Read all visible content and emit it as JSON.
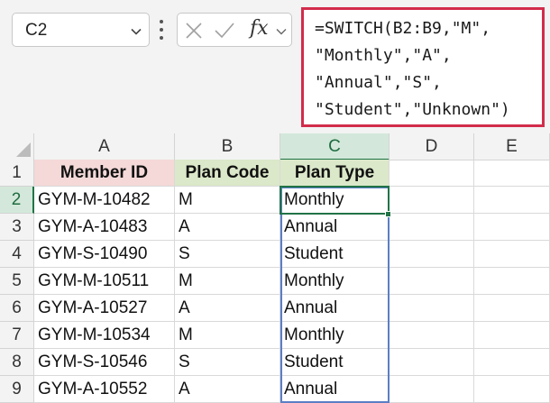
{
  "name_box": {
    "value": "C2"
  },
  "formula_bar": {
    "fx_label": "fx",
    "lines": [
      "=SWITCH(B2:B9,\"M\",",
      "\"Monthly\",\"A\",",
      "\"Annual\",\"S\",",
      "\"Student\",\"Unknown\")"
    ]
  },
  "sheet": {
    "columns": [
      "A",
      "B",
      "C",
      "D",
      "E"
    ],
    "rows": [
      "1",
      "2",
      "3",
      "4",
      "5",
      "6",
      "7",
      "8",
      "9"
    ],
    "headers": [
      "Member ID",
      "Plan Code",
      "Plan Type"
    ],
    "data": [
      [
        "GYM-M-10482",
        "M",
        "Monthly"
      ],
      [
        "GYM-A-10483",
        "A",
        "Annual"
      ],
      [
        "GYM-S-10490",
        "S",
        "Student"
      ],
      [
        "GYM-M-10511",
        "M",
        "Monthly"
      ],
      [
        "GYM-A-10527",
        "A",
        "Annual"
      ],
      [
        "GYM-M-10534",
        "M",
        "Monthly"
      ],
      [
        "GYM-S-10546",
        "S",
        "Student"
      ],
      [
        "GYM-A-10552",
        "A",
        "Annual"
      ]
    ],
    "active_cell": "C2"
  },
  "colors": {
    "formula_border": "#d22c4b",
    "header_a_fill": "#f4d9d8",
    "header_bc_fill": "#dbe8c9",
    "active_green": "#217346",
    "selection_blue": "#5b7fc4"
  },
  "icons": {
    "cancel": "x-icon",
    "confirm": "check-icon",
    "dropdown": "chevron-down-icon",
    "more": "vertical-dots-icon"
  }
}
